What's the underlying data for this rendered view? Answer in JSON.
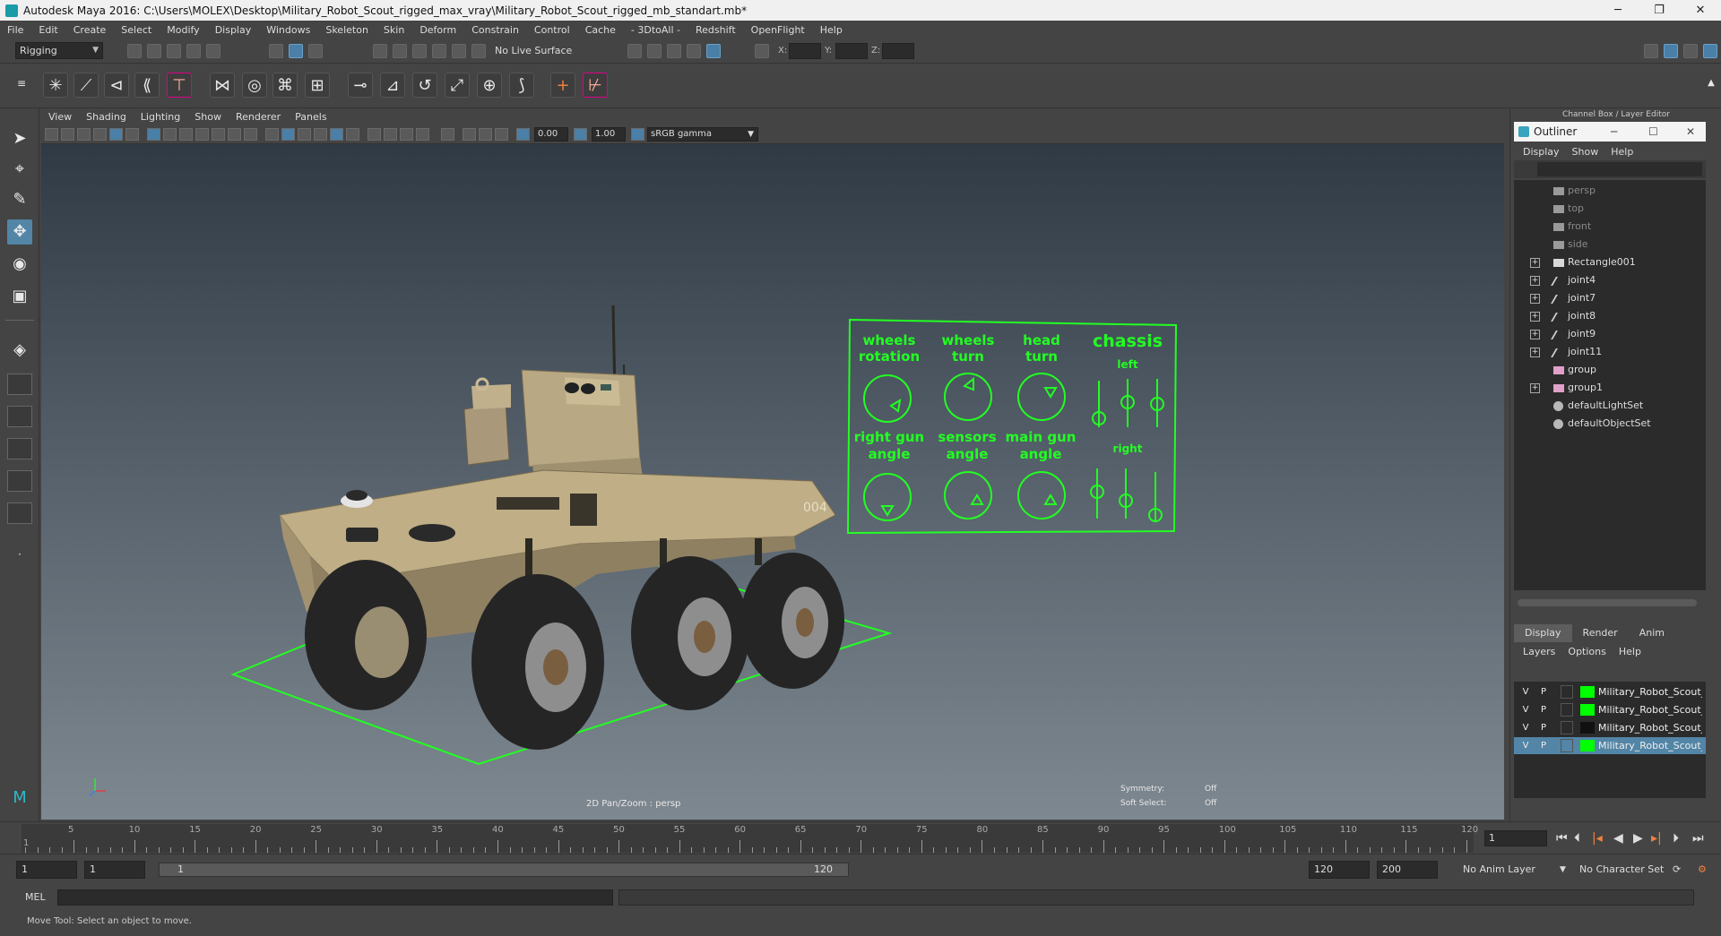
{
  "window": {
    "title": "Autodesk Maya 2016: C:\\Users\\MOLEX\\Desktop\\Military_Robot_Scout_rigged_max_vray\\Military_Robot_Scout_rigged_mb_standart.mb*",
    "minimize": "─",
    "restore": "❐",
    "close": "✕"
  },
  "menubar": [
    "File",
    "Edit",
    "Create",
    "Select",
    "Modify",
    "Display",
    "Windows",
    "Skeleton",
    "Skin",
    "Deform",
    "Constrain",
    "Control",
    "Cache",
    "- 3DtoAll -",
    "Redshift",
    "OpenFlight",
    "Help"
  ],
  "statusline": {
    "mode": "Rigging",
    "live_surface": "No Live Surface",
    "x_label": "X:",
    "y_label": "Y:",
    "z_label": "Z:"
  },
  "viewport": {
    "menu": [
      "View",
      "Shading",
      "Lighting",
      "Show",
      "Renderer",
      "Panels"
    ],
    "exposure": "0.00",
    "gamma": "1.00",
    "color_space": "sRGB gamma",
    "camera_label": "2D Pan/Zoom : persp",
    "symmetry_label": "Symmetry:",
    "symmetry_value": "Off",
    "soft_select_label": "Soft Select:",
    "soft_select_value": "Off",
    "model_number": "004",
    "accent_color": "#22ff22"
  },
  "control_panel": {
    "wheels_rotation": [
      "wheels",
      "rotation"
    ],
    "wheels_turn": [
      "wheels",
      "turn"
    ],
    "head_turn": [
      "head",
      "turn"
    ],
    "chassis": "chassis",
    "left": "left",
    "right_gun_angle": [
      "right gun",
      "angle"
    ],
    "sensors_angle": [
      "sensors",
      "angle"
    ],
    "main_gun_angle": [
      "main gun",
      "angle"
    ],
    "right": "right"
  },
  "timeline": {
    "ticks": [
      5,
      10,
      15,
      20,
      25,
      30,
      35,
      40,
      45,
      50,
      55,
      60,
      65,
      70,
      75,
      80,
      85,
      90,
      95,
      100,
      105,
      110,
      115,
      120
    ],
    "start_marker": "1",
    "current_frame": "1"
  },
  "range": {
    "start": "1",
    "playback_start": "1",
    "bar_start": "1",
    "bar_end": "120",
    "playback_end": "120",
    "end": "200",
    "anim_layer": "No Anim Layer",
    "character_set": "No Character Set"
  },
  "cmdline": {
    "label": "MEL"
  },
  "helpline": {
    "text": "Move Tool: Select an object to move."
  },
  "right_panel": {
    "header": "Channel Box / Layer Editor",
    "outliner": {
      "title": "Outliner",
      "menu": [
        "Display",
        "Show",
        "Help"
      ],
      "items": [
        {
          "label": "persp",
          "dim": true,
          "expand": false,
          "icon": "camera"
        },
        {
          "label": "top",
          "dim": true,
          "expand": false,
          "icon": "camera"
        },
        {
          "label": "front",
          "dim": true,
          "expand": false,
          "icon": "camera"
        },
        {
          "label": "side",
          "dim": true,
          "expand": false,
          "icon": "camera"
        },
        {
          "label": "Rectangle001",
          "dim": false,
          "expand": true,
          "icon": "curve"
        },
        {
          "label": "joint4",
          "dim": false,
          "expand": true,
          "icon": "joint"
        },
        {
          "label": "joint7",
          "dim": false,
          "expand": true,
          "icon": "joint"
        },
        {
          "label": "joint8",
          "dim": false,
          "expand": true,
          "icon": "joint"
        },
        {
          "label": "joint9",
          "dim": false,
          "expand": true,
          "icon": "joint"
        },
        {
          "label": "joint11",
          "dim": false,
          "expand": true,
          "icon": "joint"
        },
        {
          "label": "group",
          "dim": false,
          "expand": false,
          "icon": "group"
        },
        {
          "label": "group1",
          "dim": false,
          "expand": true,
          "icon": "group"
        },
        {
          "label": "defaultLightSet",
          "dim": false,
          "expand": false,
          "icon": "set"
        },
        {
          "label": "defaultObjectSet",
          "dim": false,
          "expand": false,
          "icon": "set"
        }
      ]
    },
    "layer_editor": {
      "tabs": [
        "Display",
        "Render",
        "Anim"
      ],
      "menu": [
        "Layers",
        "Options",
        "Help"
      ],
      "layers": [
        {
          "v": "V",
          "p": "P",
          "name": "Military_Robot_Scout_",
          "color": "#00ff00",
          "selected": false
        },
        {
          "v": "V",
          "p": "P",
          "name": "Military_Robot_Scout_",
          "color": "#00ff00",
          "selected": false
        },
        {
          "v": "V",
          "p": "P",
          "name": "Military_Robot_Scout_",
          "color": "#111111",
          "selected": false
        },
        {
          "v": "V",
          "p": "P",
          "name": "Military_Robot_Scout_",
          "color": "#00ff00",
          "selected": true
        }
      ]
    }
  }
}
